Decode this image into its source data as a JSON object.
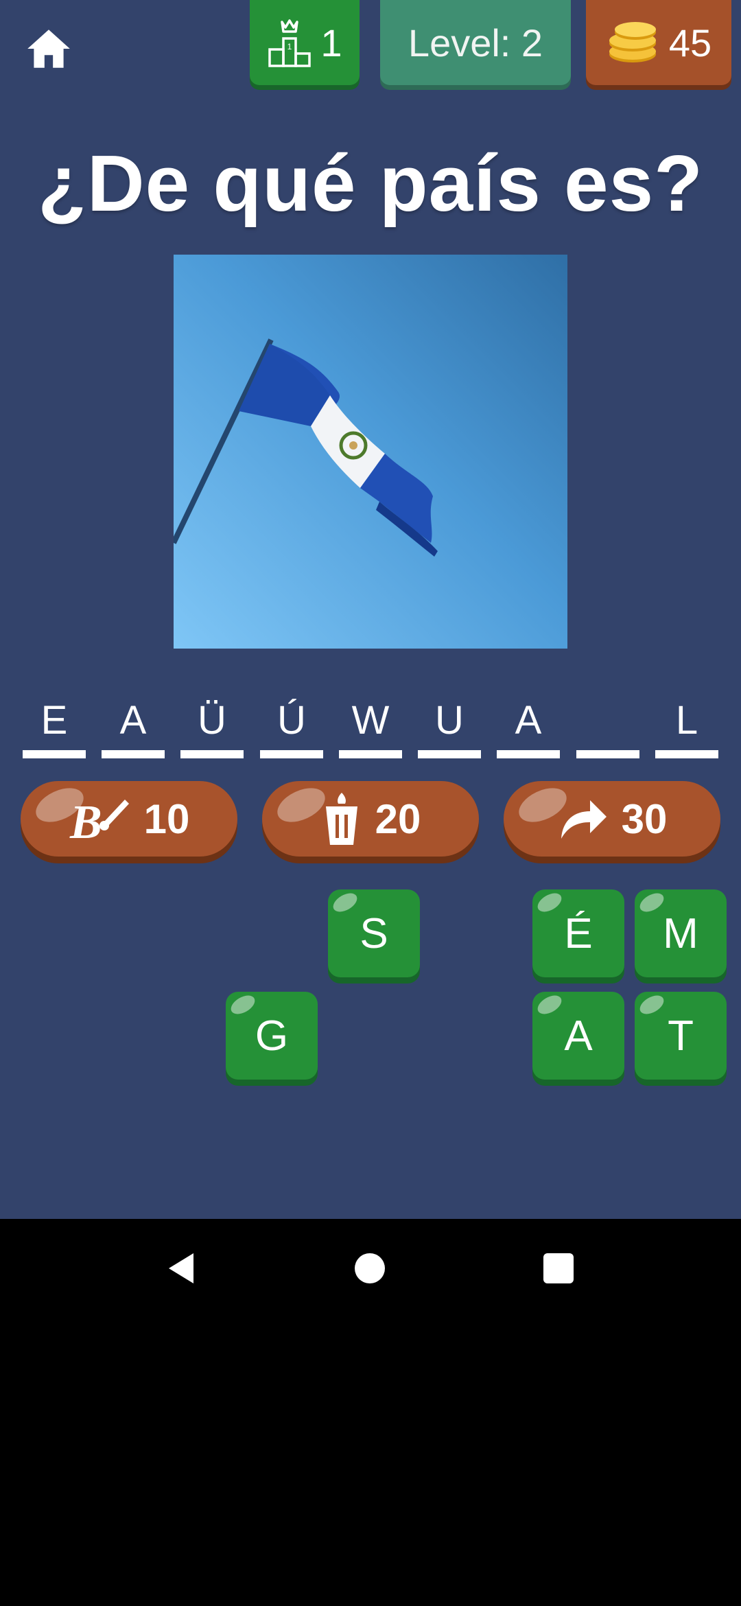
{
  "header": {
    "ranking_value": "1",
    "level_text": "Level: 2",
    "coins_value": "45"
  },
  "question": {
    "title": "¿De qué país es?"
  },
  "answer_slots": [
    "E",
    "A",
    "Ü",
    "Ú",
    "W",
    "U",
    "A",
    "",
    "L"
  ],
  "hints": [
    {
      "name": "paint-hint",
      "icon": "paintbrush-b-icon",
      "cost": "10"
    },
    {
      "name": "delete-hint",
      "icon": "trash-bin-icon",
      "cost": "20"
    },
    {
      "name": "skip-hint",
      "icon": "forward-arrow-icon",
      "cost": "30"
    }
  ],
  "letter_tiles": {
    "row1": [
      "S",
      "É",
      "M"
    ],
    "row2": [
      "G",
      "A",
      "T"
    ]
  },
  "colors": {
    "background": "#33436b",
    "green_button": "#259137",
    "orange_button": "#a8532c",
    "level_box": "#3f8f72"
  }
}
